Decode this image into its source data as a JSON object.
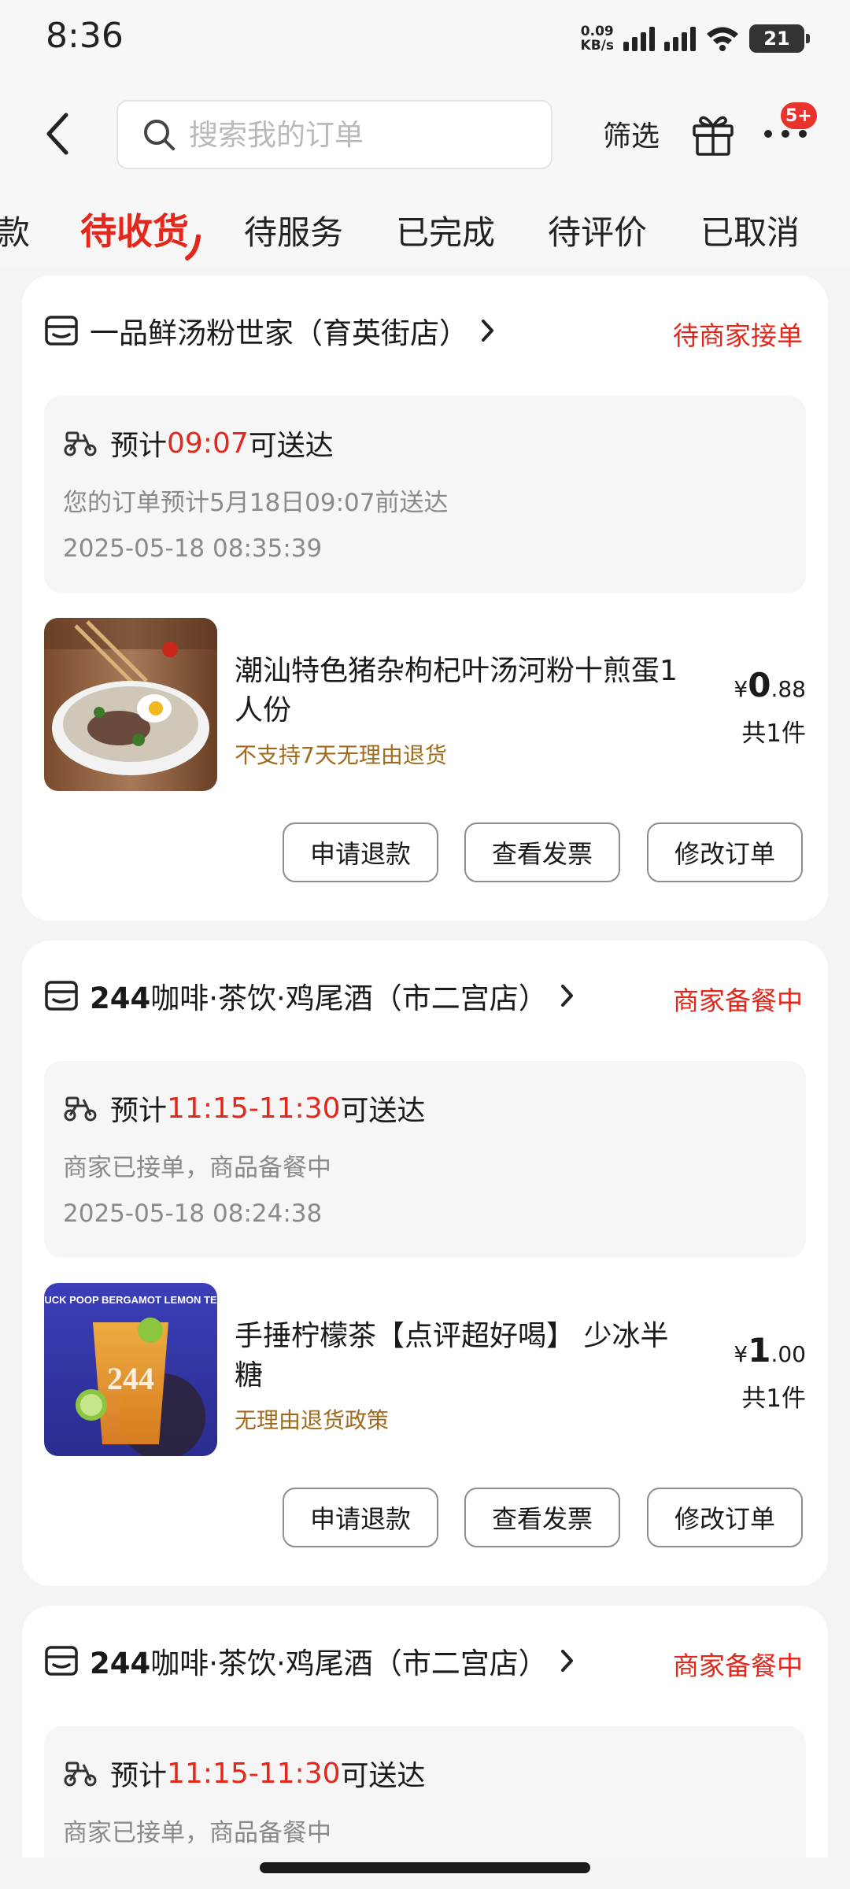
{
  "status_bar": {
    "time": "8:36",
    "net_speed_value": "0.09",
    "net_speed_unit": "KB/s",
    "battery": "21"
  },
  "header": {
    "search_placeholder": "搜索我的订单",
    "filter_label": "筛选",
    "more_badge": "5+"
  },
  "tabs": [
    {
      "label": "款"
    },
    {
      "label": "待收货",
      "active": true
    },
    {
      "label": "待服务"
    },
    {
      "label": "已完成"
    },
    {
      "label": "待评价"
    },
    {
      "label": "已取消"
    }
  ],
  "orders": [
    {
      "store_name": "一品鲜汤粉世家（育英街店）",
      "store_num": "",
      "status": "待商家接单",
      "eta_prefix": "预计",
      "eta_time": "09:07",
      "eta_suffix": "可送达",
      "eta_desc": "您的订单预计5月18日09:07前送达",
      "order_time": "2025-05-18 08:35:39",
      "product_title": "潮汕特色猪杂枸杞叶汤河粉十煎蛋1人份",
      "product_policy": "不支持7天无理由退货",
      "price_symbol": "¥",
      "price_int": "0",
      "price_dec": ".88",
      "qty": "共1件",
      "buttons": [
        "申请退款",
        "查看发票",
        "修改订单"
      ]
    },
    {
      "store_num": "244",
      "store_name": "咖啡·茶饮·鸡尾酒（市二宫店）",
      "status": "商家备餐中",
      "eta_prefix": "预计",
      "eta_time": "11:15-11:30",
      "eta_suffix": "可送达",
      "eta_desc": "商家已接单，商品备餐中",
      "order_time": "2025-05-18 08:24:38",
      "product_title": "手捶柠檬茶【点评超好喝】 少冰半糖",
      "product_policy": "无理由退货政策",
      "product_image_text": "DUCK POOP BERGAMOT LEMON TEA",
      "price_symbol": "¥",
      "price_int": "1",
      "price_dec": ".00",
      "qty": "共1件",
      "buttons": [
        "申请退款",
        "查看发票",
        "修改订单"
      ]
    },
    {
      "store_num": "244",
      "store_name": "咖啡·茶饮·鸡尾酒（市二宫店）",
      "status": "商家备餐中",
      "eta_prefix": "预计",
      "eta_time": "11:15-11:30",
      "eta_suffix": "可送达",
      "eta_desc": "商家已接单，商品备餐中"
    }
  ],
  "colors": {
    "accent": "#e2271b",
    "policy": "#a06a1a",
    "muted": "#8a8a8a"
  }
}
